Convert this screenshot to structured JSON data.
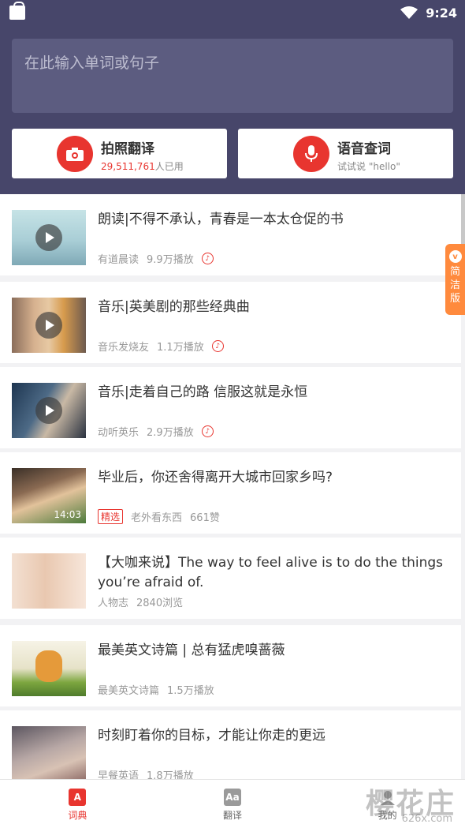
{
  "statusbar": {
    "time": "9:24"
  },
  "search": {
    "placeholder": "在此输入单词或句子"
  },
  "actions": {
    "photo": {
      "title": "拍照翻译",
      "count": "29,511,761",
      "suffix": "人已用"
    },
    "voice": {
      "title": "语音查词",
      "hint": "试试说 \"hello\""
    }
  },
  "side_tab": {
    "chars": [
      "简",
      "洁",
      "版"
    ]
  },
  "feed": [
    {
      "title": "朗读|不得不承认，青春是一本太仓促的书",
      "source": "有道晨读",
      "stat": "9.9万播放",
      "has_play": true
    },
    {
      "title": "音乐|英美剧的那些经典曲",
      "source": "音乐发烧友",
      "stat": "1.1万播放",
      "has_play": true
    },
    {
      "title": "音乐|走着自己的路 信服这就是永恒",
      "source": "动听英乐",
      "stat": "2.9万播放",
      "has_play": true
    },
    {
      "title": "毕业后，你还舍得离开大城市回家乡吗?",
      "tag": "精选",
      "source": "老外看东西",
      "stat": "661赞",
      "duration": "14:03"
    },
    {
      "title": "【大咖来说】The way to feel alive is to do the things you’re afraid of.",
      "source": "人物志",
      "stat": "2840浏览"
    },
    {
      "title": "最美英文诗篇 | 总有猛虎嗅蔷薇",
      "source": "最美英文诗篇",
      "stat": "1.5万播放"
    },
    {
      "title": "时刻盯着你的目标，才能让你走的更远",
      "source": "早餐英语",
      "stat": "1.8万播放"
    }
  ],
  "bottom_nav": [
    {
      "label": "词典",
      "icon": "A"
    },
    {
      "label": "翻译",
      "icon": "Aa"
    },
    {
      "label": "我的"
    }
  ],
  "watermark": {
    "text": "樱花庄",
    "sub": "626x.com"
  },
  "colors": {
    "header": "#47466a",
    "accent": "#e8352f",
    "side_tab": "#ff8a3d"
  }
}
